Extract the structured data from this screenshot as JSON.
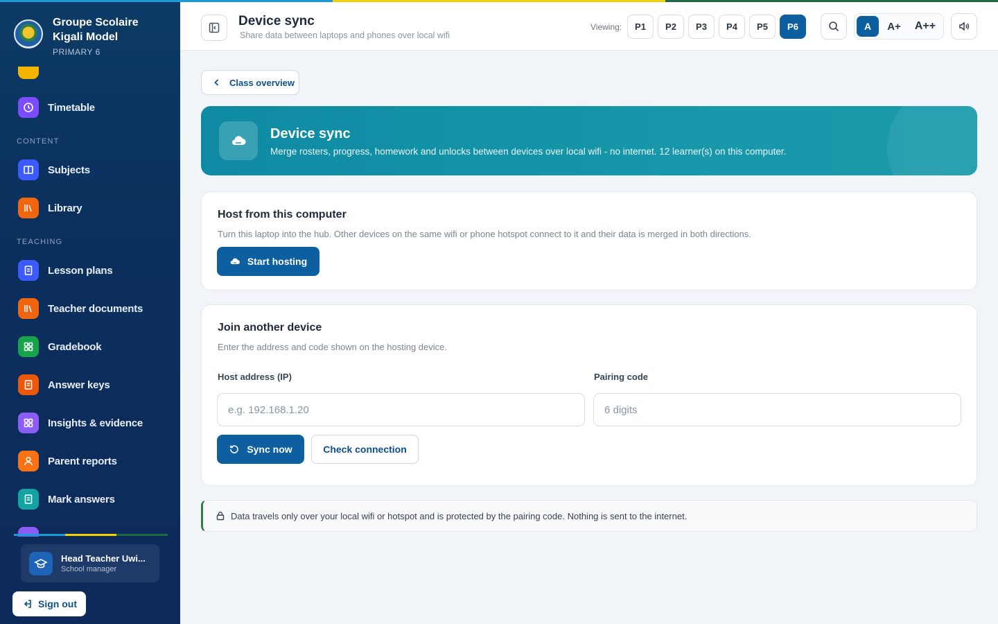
{
  "colors": {
    "flag": [
      "#1a9ad6",
      "#f4d000",
      "#1d6b43"
    ],
    "accent": "#0d5fa0",
    "hero": "#1797aa"
  },
  "school": {
    "name": "Groupe Scolaire Kigali Model",
    "class": "PRIMARY 6"
  },
  "sidebar": {
    "items_top": [
      {
        "label": "Timetable",
        "icon": "clock-icon",
        "color": "#7c4dff"
      }
    ],
    "sections": [
      {
        "title": "CONTENT",
        "items": [
          {
            "label": "Subjects",
            "icon": "book-open-icon",
            "color": "#3d5afe"
          },
          {
            "label": "Library",
            "icon": "books-icon",
            "color": "#f0650f"
          }
        ]
      },
      {
        "title": "TEACHING",
        "items": [
          {
            "label": "Lesson plans",
            "icon": "document-icon",
            "color": "#3d5afe"
          },
          {
            "label": "Teacher documents",
            "icon": "books-icon",
            "color": "#f0650f"
          },
          {
            "label": "Gradebook",
            "icon": "grid-icon",
            "color": "#16a34a"
          },
          {
            "label": "Answer keys",
            "icon": "document-icon",
            "color": "#ea580c"
          },
          {
            "label": "Insights & evidence",
            "icon": "grid-icon",
            "color": "#8b5cf6"
          },
          {
            "label": "Parent reports",
            "icon": "person-icon",
            "color": "#f97316"
          },
          {
            "label": "Mark answers",
            "icon": "document-icon",
            "color": "#14a3a3"
          }
        ]
      }
    ]
  },
  "user": {
    "name": "Head Teacher Uwi...",
    "role": "School manager"
  },
  "signout_label": "Sign out",
  "header": {
    "title": "Device sync",
    "subtitle": "Share data between laptops and phones over local wifi",
    "viewing_label": "Viewing:",
    "grades": [
      "P1",
      "P2",
      "P3",
      "P4",
      "P5",
      "P6"
    ],
    "active_grade": "P6",
    "font_sizes": [
      "A",
      "A+",
      "A++"
    ],
    "active_font": "A"
  },
  "back_label": "Class overview",
  "hero": {
    "title": "Device sync",
    "description": "Merge rosters, progress, homework and unlocks between devices over local wifi - no internet. 12 learner(s) on this computer."
  },
  "host": {
    "title": "Host from this computer",
    "description": "Turn this laptop into the hub. Other devices on the same wifi or phone hotspot connect to it and their data is merged in both directions.",
    "button": "Start hosting"
  },
  "join": {
    "title": "Join another device",
    "description": "Enter the address and code shown on the hosting device.",
    "ip_label": "Host address (IP)",
    "ip_placeholder": "e.g. 192.168.1.20",
    "ip_value": "",
    "code_label": "Pairing code",
    "code_placeholder": "6 digits",
    "code_value": "",
    "sync_button": "Sync now",
    "check_button": "Check connection"
  },
  "notice": "Data travels only over your local wifi or hotspot and is protected by the pairing code. Nothing is sent to the internet."
}
